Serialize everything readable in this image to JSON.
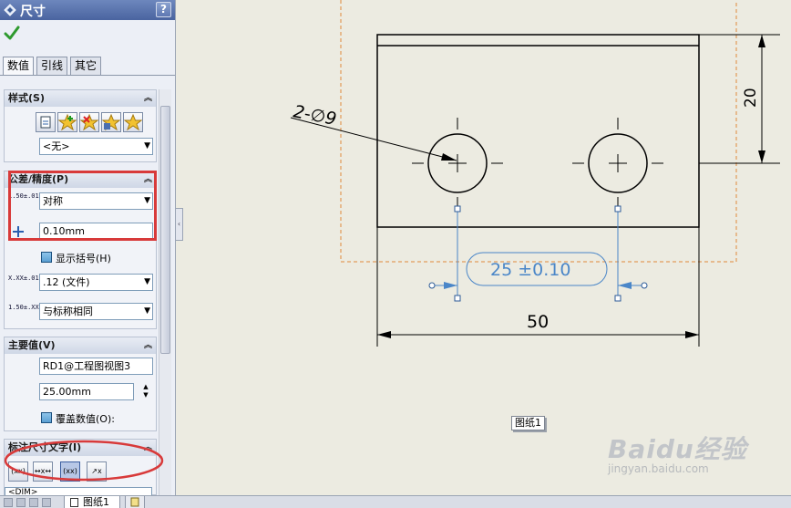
{
  "window": {
    "title": "尺寸",
    "help_label": "?"
  },
  "tabs": [
    {
      "label": "数值"
    },
    {
      "label": "引线"
    },
    {
      "label": "其它"
    }
  ],
  "style_group": {
    "title": "样式(S)",
    "style_value": "<无>"
  },
  "tolerance_group": {
    "title": "公差/精度(P)",
    "tolerance_icon": "1.50±.01",
    "tolerance_type": "对称",
    "tolerance_value": "0.10mm",
    "show_parentheses_label": "显示括号(H)",
    "precision_icon": "X.XX±.01",
    "precision_value": ".12 (文件)",
    "tolerance_precision_icon": "1.50±.XX",
    "tolerance_precision_value": "与标称相同"
  },
  "primary_group": {
    "title": "主要值(V)",
    "name_value": "RD1@工程图视图3",
    "dimension_value": "25.00mm",
    "override_label": "覆盖数值(O):"
  },
  "text_group": {
    "title": "标注尺寸文字(I)",
    "btn_labels": [
      "(xx)",
      "↔x↔",
      "(xx)",
      "↗x"
    ],
    "dim_text": "<DIM>"
  },
  "status_bar": {
    "sheet_tab_label": "图纸1"
  },
  "drawing": {
    "hole_callout": "2-∅9",
    "dim_height": "20",
    "dim_center": "25 ±0.10",
    "dim_width": "50",
    "sheet_label": "图纸1"
  },
  "watermark": {
    "main": "Baidu经验",
    "sub": "jingyan.baidu.com"
  },
  "colors": {
    "highlight_red": "#d83a3a",
    "selection_orange": "#e08a3a",
    "dim_blue": "#4a86c8",
    "accent_title": "#4a64a0"
  }
}
